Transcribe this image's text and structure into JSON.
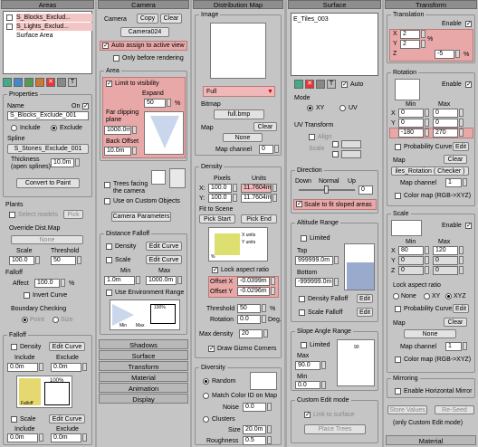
{
  "col1": {
    "header": "Areas",
    "list": [
      "S_Blocks_Exclud...",
      "S_Lights_Exclud...",
      "Surface Area"
    ],
    "props_title": "Properties",
    "name_label": "Name",
    "on_label": "On",
    "name_value": "S_Blocks_Exclude_001",
    "include": "Include",
    "exclude": "Exclude",
    "spline_label": "Spline",
    "spline_value": "S_Stones_Exclude_001",
    "thickness_label": "Thickness\n(open splines)",
    "thickness_value": "10.0m",
    "convert": "Convert to Paint",
    "plants_title": "Plants",
    "select_models": "Select models",
    "pick": "Pick",
    "override_title": "Override Dist.Map",
    "none": "None",
    "scale_label": "Scale",
    "threshold_label": "Threshold",
    "scale_value": "100.0",
    "threshold_value": "50",
    "falloff_title": "Falloff",
    "affect_label": "Affect",
    "affect_value": "100.0",
    "invert": "Invert Curve",
    "boundary_title": "Boundary Checking",
    "point": "Point",
    "size": "Size",
    "falloff2_title": "Falloff",
    "density": "Density",
    "edit_curve": "Edit Curve",
    "include2": "Include",
    "exclude2": "Exclude",
    "f_in": "0.0m",
    "f_ex": "0.0m",
    "scale2": "Scale",
    "s_in": "0.0m",
    "s_ex": "0.0m",
    "fig_label": "100%",
    "fig_label2": "Falloff"
  },
  "col2": {
    "header": "Camera",
    "camera_label": "Camera",
    "copy": "Copy",
    "clear": "Clear",
    "camera_value": "Camera024",
    "auto": "Auto assign to active view",
    "only_before": "Only before rendering",
    "area_title": "Area",
    "limit": "Limit to visibility",
    "expand": "Expand",
    "expand_value": "50",
    "pct": "%",
    "far_label": "Far clipping\nplane",
    "far_value": "1000.0m",
    "back_label": "Back Offset",
    "back_value": "10.0m",
    "trees_facing": "Trees facing\nthe camera",
    "custom_objects": "Use on Custom Objects",
    "cam_params": "Camera Parameters",
    "dist_falloff": "Distance Falloff",
    "density": "Density",
    "edit_curve": "Edit Curve",
    "scale": "Scale",
    "min": "Min",
    "max": "Max",
    "min_value": "1.0m",
    "max_value": "1000.0m",
    "env_range": "Use Environment Range",
    "fig_min": "Min",
    "fig_max": "Max",
    "fig_pct": "100%",
    "rollouts": [
      "Shadows",
      "Surface",
      "Transform",
      "Material",
      "Animation",
      "Display"
    ]
  },
  "col3": {
    "header": "Distribution Map",
    "image_title": "Image",
    "map_type": "Full",
    "bitmap_label": "Bitmap",
    "bitmap_value": "full.bmp",
    "map_label": "Map",
    "clear": "Clear",
    "none": "None",
    "map_channel": "Map channel",
    "map_channel_value": "0",
    "density_title": "Density",
    "pixels": "Pixels",
    "units": "Units",
    "x_label": "X:",
    "y_label": "Y:",
    "x_px": "100.0",
    "y_px": "100.0",
    "x_un": "11.7604m",
    "y_un": "11.7604m",
    "fit_scene": "Fit to Scene",
    "pick_start": "Pick Start",
    "pick_end": "Pick End",
    "lock_aspect": "Lock aspect ratio",
    "offx_label": "Offset X",
    "offy_label": "Offset Y",
    "offx_value": "-0.0399m",
    "offy_value": "-0.0296m",
    "threshold_label": "Threshold",
    "threshold_value": "50",
    "rotation_label": "Rotation",
    "rotation_value": "0.0",
    "deg": "Deg.",
    "maxdens_label": "Max density",
    "maxdens_value": "20",
    "draw_gizmo": "Draw Gizmo Corners",
    "diversity_title": "Diversity",
    "random": "Random",
    "match_color": "Match Color ID on Map",
    "noise_label": "Noise",
    "noise_value": "0.0",
    "clusters": "Clusters",
    "size_label": "Size",
    "size_value": "20.0m",
    "rough_label": "Roughness",
    "rough_value": "0.5",
    "fig_xunits": "X units",
    "fig_yunits": "Y units",
    "fig_pct": "%"
  },
  "col4": {
    "header": "Surface",
    "list": [
      "E_Tiles_003"
    ],
    "auto": "Auto",
    "mode_title": "Mode",
    "xy": "XY",
    "uv": "UV",
    "uv_transform": "UV Transform",
    "align": "Align",
    "scale": "Scale",
    "direction_title": "Direction",
    "down": "Down",
    "normal": "Normal",
    "up": "Up",
    "direction_value": "0",
    "scale_fit": "Scale to fit sloped areas",
    "altitude_title": "Altitude Range",
    "limited": "Limited",
    "top": "Top",
    "top_value": "999999.0m",
    "bottom": "Bottom",
    "bottom_value": "-999999.0m",
    "density_falloff": "Density Falloff",
    "edit": "Edit",
    "scale_falloff": "Scale Falloff",
    "slope_title": "Slope Angle Range",
    "max": "Max",
    "max_value": "90.0",
    "min": "Min",
    "min_value": "0.0",
    "custom_edit": "Custom Edit mode",
    "link_surface": "Link to surface",
    "place_trees": "Place Trees",
    "fig_val": "90"
  },
  "col5": {
    "header": "Transform",
    "translation": "Translation",
    "enable": "Enable",
    "tx": "2",
    "ty": "2",
    "tz": "-5",
    "pct": "%",
    "rotation": "Rotation",
    "min": "Min",
    "max": "Max",
    "rx_min": "0",
    "rx_max": "0",
    "ry_min": "0",
    "ry_max": "0",
    "rz_min": "-180",
    "rz_max": "270",
    "prob_curve": "Probability Curve",
    "edit": "Edit",
    "map": "Map",
    "clear": "Clear",
    "map_value": "iles_Rotation ( Checker )",
    "map_channel": "Map channel",
    "map_channel_value": "1",
    "color_map": "Color map (RGB->XYZ)",
    "scale": "Scale",
    "sx_min": "80",
    "sx_max": "120",
    "sy_min": "0",
    "sy_max": "0",
    "sz_min": "0",
    "sz_max": "0",
    "lock_aspect": "Lock aspect ratio",
    "none": "None",
    "xy": "XY",
    "xyz": "XYZ",
    "mirroring": "Mirroring",
    "enable_h": "Enable Horizontal Mirror",
    "store": "Store Values",
    "reseed": "Re-Seed",
    "only_custom": "(only Custom Edit mode)",
    "material": "Material"
  }
}
